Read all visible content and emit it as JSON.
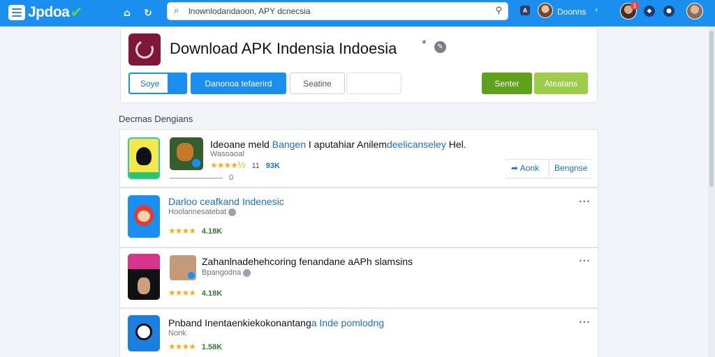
{
  "topbar": {
    "logo": "Jpdoa",
    "search_query": "lnownlodandaoon, APY dcnecsia",
    "user_badge": "A",
    "user_name": "Doonns",
    "notification_count": "1",
    "accent_color": "#1b8ff0"
  },
  "header": {
    "title": "Download APK Indensia Indoesia",
    "title_mark": "*",
    "buttons": {
      "save": "Soye",
      "download": "Danonoa tefaerird",
      "secondary": "Seatine",
      "center": "Senter",
      "aux": "Ateatans"
    }
  },
  "section_label": "Decmas Dengians",
  "list": [
    {
      "title_dark": "Ideoane meld ",
      "title_blue": "Bangen",
      "title_rest": " I aputahiar Anilem",
      "title_blue2": "deelicanseley",
      "title_tail": " Hel.",
      "subtitle": "Wasoaoal",
      "rating": "★★★★½",
      "count": "11",
      "size": "93K",
      "meta": "0",
      "share_label": "Aonk",
      "detail_label": "Bengnse"
    },
    {
      "title": "Darloo ceafkand Indenesic",
      "subtitle": "Hoolannesatebat",
      "rating": "★★★★",
      "size": "4.18K"
    },
    {
      "title": "Zahanlnadehehcoring fenandane aAPh slamsins",
      "subtitle": "Bpangodna",
      "rating": "★★★★",
      "size": "4.18K"
    },
    {
      "title_dark": "Pnband Inentaenkiekokonantang",
      "title_blue": "a Inde pomlodng",
      "subtitle": "Nonk",
      "rating": "★★★★",
      "size": "1.58K"
    }
  ]
}
